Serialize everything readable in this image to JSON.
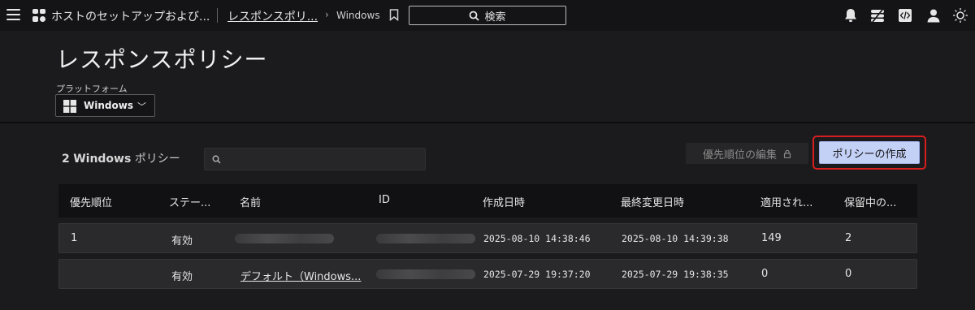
{
  "nav": {
    "breadcrumb_1": "ホストのセットアップおよび...",
    "breadcrumb_2": "レスポンスポリ...",
    "breadcrumb_3": "Windows",
    "search_label": "検索"
  },
  "page": {
    "title": "レスポンスポリシー",
    "platform_label": "プラットフォーム",
    "platform_value": "Windows"
  },
  "list": {
    "count": "2",
    "count_platform": "Windows",
    "count_suffix": "ポリシー",
    "edit_priority_label": "優先順位の編集",
    "create_label": "ポリシーの作成"
  },
  "table": {
    "headers": [
      "優先順位",
      "ステー...",
      "名前",
      "ID",
      "作成日時",
      "最終変更日時",
      "適用され...",
      "保留中の..."
    ],
    "rows": [
      {
        "priority": "1",
        "status": "有効",
        "name": "",
        "id": "",
        "created": "2025-08-10 14:38:46",
        "modified": "2025-08-10 14:39:38",
        "applied": "149",
        "pending": "2"
      },
      {
        "priority": "",
        "status": "有効",
        "name": "デフォルト（Windows...",
        "id": "",
        "created": "2025-07-29 19:37:20",
        "modified": "2025-07-29 19:38:35",
        "applied": "0",
        "pending": "0"
      }
    ]
  },
  "colors": {
    "accent_button": "#c4d1f6",
    "highlight_border": "#d81e1e",
    "background": "#1b1b1d"
  },
  "icons": [
    "menu-icon",
    "app-icon",
    "bookmark-icon",
    "search-icon",
    "bell-icon",
    "layers-icon",
    "code-icon",
    "user-icon",
    "sun-icon",
    "windows-icon",
    "chevron-down-icon",
    "lock-icon"
  ]
}
